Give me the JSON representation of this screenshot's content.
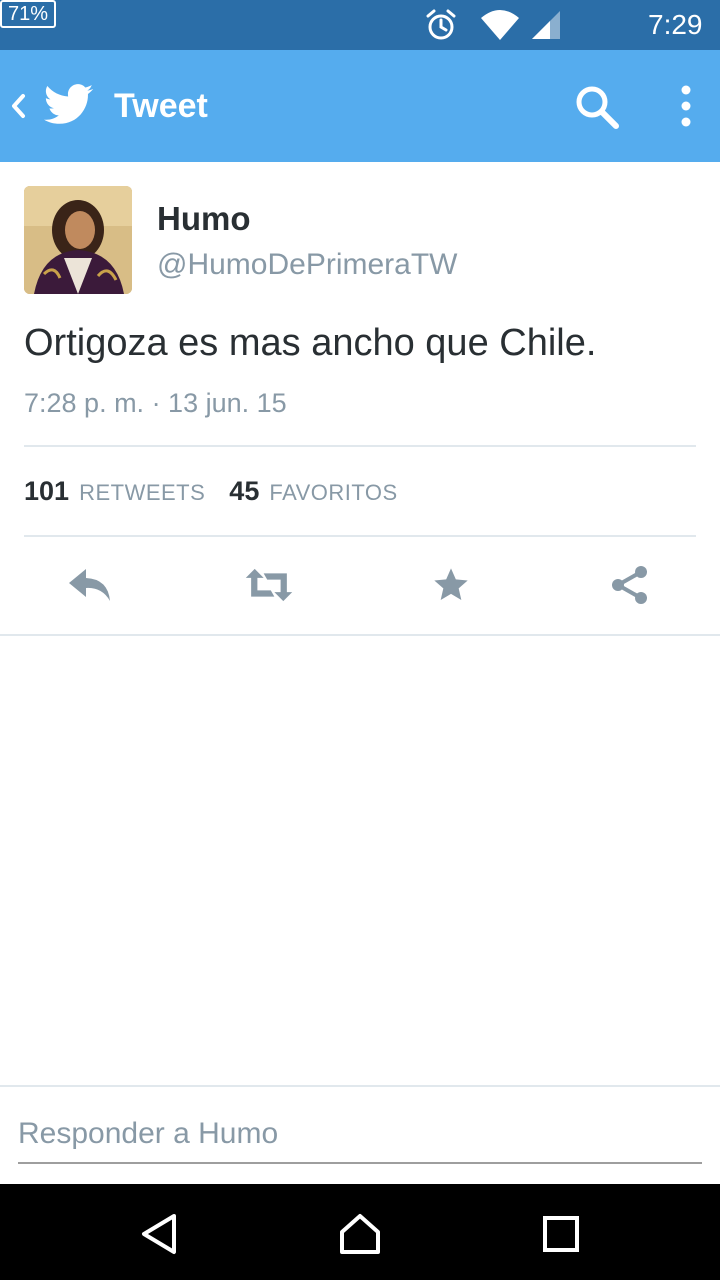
{
  "status_bar": {
    "battery": "71%",
    "time": "7:29",
    "icons": [
      "alarm-icon",
      "wifi-icon",
      "signal-icon",
      "battery-icon"
    ]
  },
  "app_bar": {
    "title": "Tweet",
    "icons": [
      "back-chevron-icon",
      "twitter-bird-icon",
      "search-icon",
      "overflow-menu-icon"
    ],
    "color": "#55acee"
  },
  "tweet": {
    "author_name": "Humo",
    "author_handle": "@HumoDePrimeraTW",
    "text": "Ortigoza es mas ancho que Chile.",
    "timestamp": "7:28 p. m. · 13 jun. 15",
    "stats": {
      "retweets_count": "101",
      "retweets_label": "RETWEETS",
      "favorites_count": "45",
      "favorites_label": "FAVORITOS"
    },
    "actions": [
      "reply-icon",
      "retweet-icon",
      "favorite-star-icon",
      "share-icon"
    ]
  },
  "reply": {
    "placeholder": "Responder a Humo"
  },
  "nav_bar": {
    "icons": [
      "nav-back-icon",
      "nav-home-icon",
      "nav-recents-icon"
    ]
  }
}
